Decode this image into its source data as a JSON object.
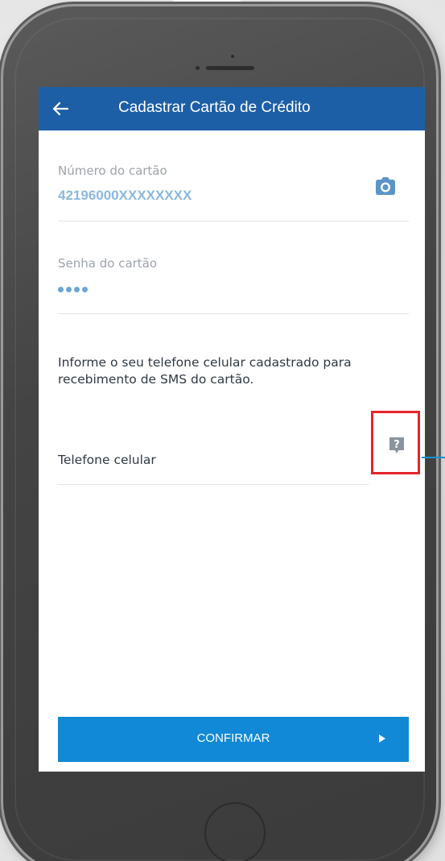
{
  "colors": {
    "appbar": "#1d5fa6",
    "primary_button": "#1189d6",
    "highlight": "#e6242b",
    "value_text": "#8bb8dd",
    "label_text": "#9da3aa"
  },
  "header": {
    "back_icon": "arrow-left-icon",
    "title": "Cadastrar Cartão de Crédito"
  },
  "form": {
    "card_number": {
      "label": "Número do cartão",
      "value": "42196000XXXXXXXX",
      "action_icon": "camera-icon"
    },
    "card_password": {
      "label": "Senha do cartão",
      "masked_length": 4
    },
    "info_text": "Informe o seu telefone celular cadastrado para recebimento de SMS do cartão.",
    "mobile_phone": {
      "label": "Telefone celular",
      "help_icon": "question-mark-icon"
    }
  },
  "footer": {
    "confirm_label": "CONFIRMAR",
    "confirm_icon": "play-arrow-icon"
  }
}
